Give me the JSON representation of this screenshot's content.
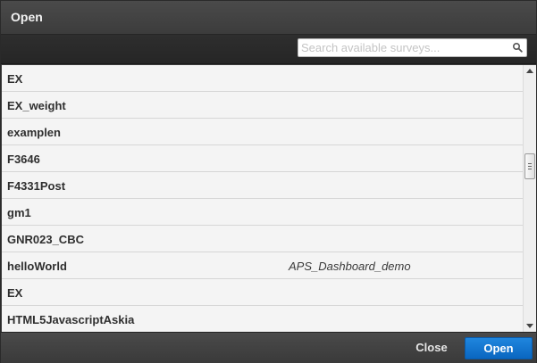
{
  "dialog": {
    "title": "Open"
  },
  "search": {
    "placeholder": "Search available surveys...",
    "value": "",
    "icon": "search-icon"
  },
  "surveys": [
    {
      "name": "EX",
      "extra": ""
    },
    {
      "name": "EX_weight",
      "extra": ""
    },
    {
      "name": "examplen",
      "extra": ""
    },
    {
      "name": "F3646",
      "extra": ""
    },
    {
      "name": "F4331Post",
      "extra": ""
    },
    {
      "name": "gm1",
      "extra": ""
    },
    {
      "name": "GNR023_CBC",
      "extra": ""
    },
    {
      "name": "helloWorld",
      "extra": "APS_Dashboard_demo"
    },
    {
      "name": "EX",
      "extra": ""
    },
    {
      "name": "HTML5JavascriptAskia",
      "extra": ""
    }
  ],
  "footer": {
    "close_label": "Close",
    "open_label": "Open"
  },
  "colors": {
    "primary_button": "#0a66c0",
    "chrome": "#3a3a3a",
    "list_background": "#f4f4f4"
  }
}
